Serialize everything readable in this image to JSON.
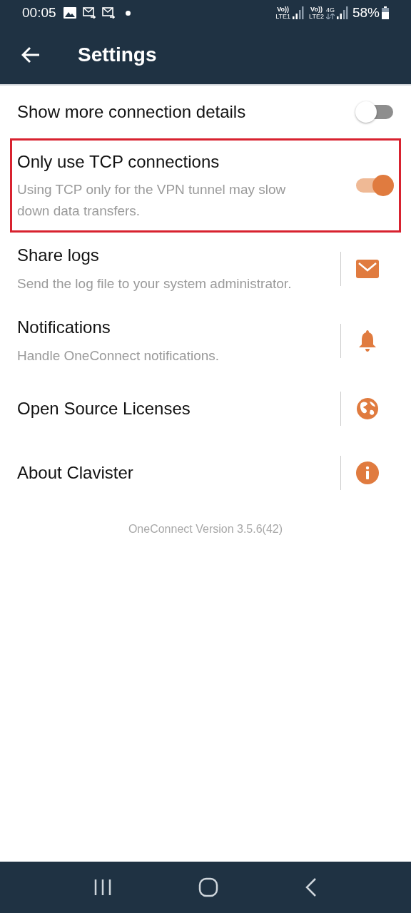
{
  "status_bar": {
    "time": "00:05",
    "sim1": {
      "volte": "Vo))",
      "label": "LTE1"
    },
    "sim2": {
      "volte": "Vo))",
      "label": "LTE2",
      "network": "4G"
    },
    "battery": "58%"
  },
  "app_bar": {
    "title": "Settings"
  },
  "items": [
    {
      "kind": "toggle",
      "title": "Show more connection details",
      "on": false,
      "highlighted": false
    },
    {
      "kind": "toggle",
      "title": "Only use TCP connections",
      "subtitle": "Using TCP only for the VPN tunnel may slow down data transfers.",
      "on": true,
      "highlighted": true
    },
    {
      "kind": "link",
      "title": "Share logs",
      "subtitle": "Send the log file to your system administrator."
    },
    {
      "kind": "link",
      "title": "Notifications",
      "subtitle": "Handle OneConnect notifications."
    },
    {
      "kind": "link",
      "title": "Open Source Licenses"
    },
    {
      "kind": "link",
      "title": "About Clavister"
    }
  ],
  "version": "OneConnect Version 3.5.6(42)"
}
